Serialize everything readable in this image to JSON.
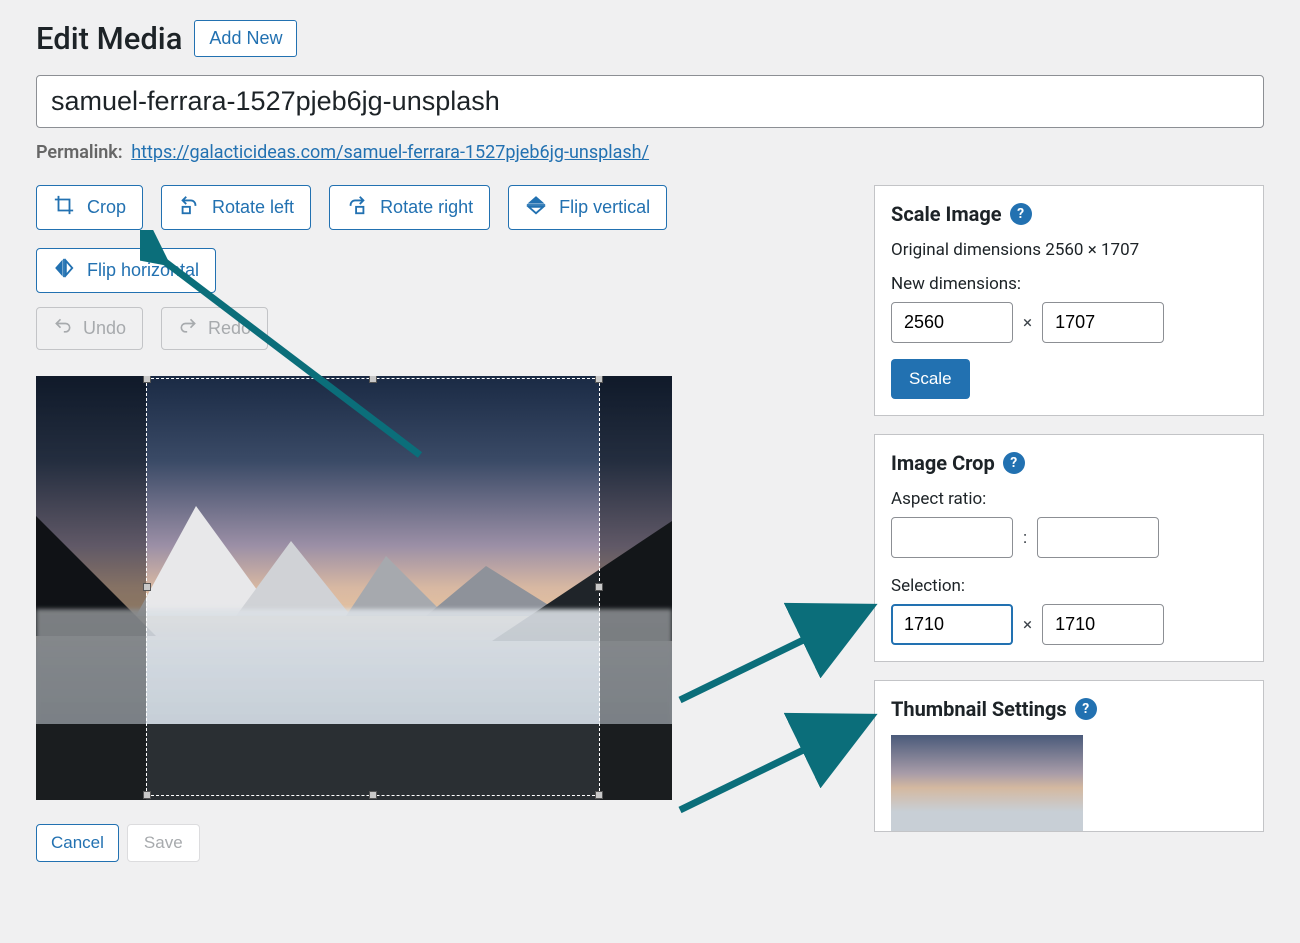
{
  "header": {
    "title": "Edit Media",
    "add_new": "Add New"
  },
  "media_title": "samuel-ferrara-1527pjeb6jg-unsplash",
  "permalink": {
    "label": "Permalink:",
    "url": "https://galacticideas.com/samuel-ferrara-1527pjeb6jg-unsplash/"
  },
  "toolbar": {
    "crop": "Crop",
    "rotate_left": "Rotate left",
    "rotate_right": "Rotate right",
    "flip_vertical": "Flip vertical",
    "flip_horizontal": "Flip horizontal",
    "undo": "Undo",
    "redo": "Redo"
  },
  "bottom": {
    "cancel": "Cancel",
    "save": "Save"
  },
  "scale": {
    "heading": "Scale Image",
    "original_label": "Original dimensions 2560 × 1707",
    "new_label": "New dimensions:",
    "width": "2560",
    "height": "1707",
    "button": "Scale"
  },
  "crop": {
    "heading": "Image Crop",
    "aspect_label": "Aspect ratio:",
    "aspect_w": "",
    "aspect_h": "",
    "selection_label": "Selection:",
    "sel_w": "1710",
    "sel_h": "1710"
  },
  "thumb": {
    "heading": "Thumbnail Settings"
  }
}
